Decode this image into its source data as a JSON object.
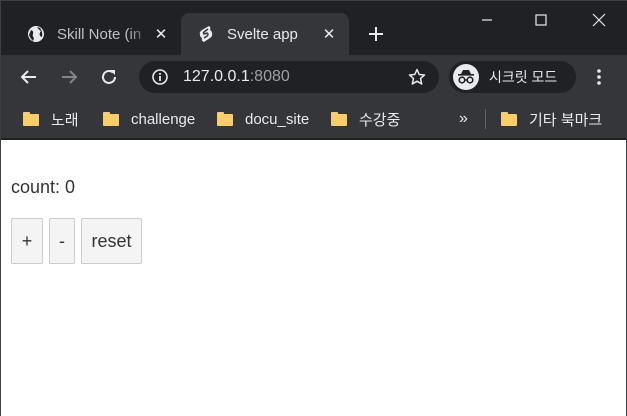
{
  "tabs": [
    {
      "title": "Skill Note (in",
      "icon": "globe-icon",
      "active": false
    },
    {
      "title": "Svelte app",
      "icon": "svelte-icon",
      "active": true
    }
  ],
  "toolbar": {
    "url_host": "127.0.0.1",
    "url_port": ":8080",
    "incognito_label": "시크릿 모드"
  },
  "bookmarks": {
    "items": [
      "노래",
      "challenge",
      "docu_site",
      "수강중"
    ],
    "overflow": "»",
    "other": "기타 북마크"
  },
  "app": {
    "count_label": "count: 0",
    "buttons": {
      "plus": "+",
      "minus": "-",
      "reset": "reset"
    }
  }
}
